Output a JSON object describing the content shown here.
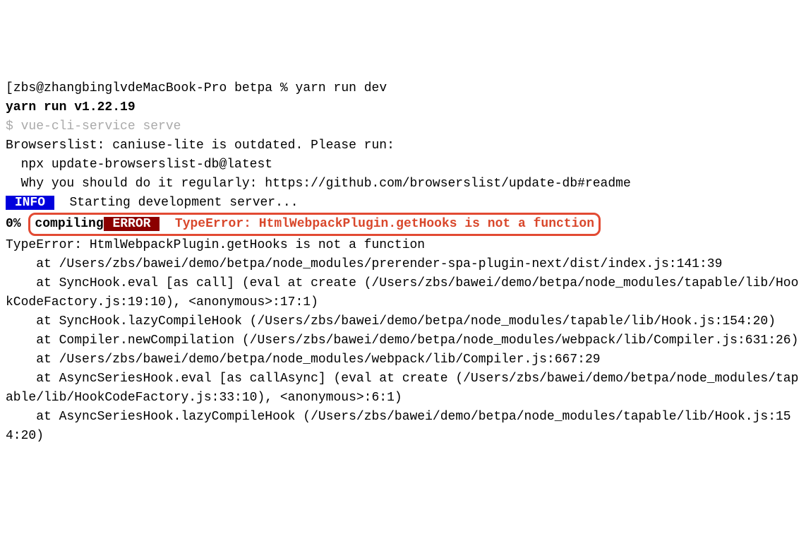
{
  "prompt": {
    "open_bracket": "[",
    "user_host": "zbs@zhangbinglvdeMacBook-Pro",
    "space1": " ",
    "dir": "betpa",
    "space2": " ",
    "pct": "%",
    "space3": " ",
    "command": "yarn run dev"
  },
  "yarn_version": "yarn run v1.22.19",
  "sub_prompt": {
    "dollar": "$",
    "space": " ",
    "cmd": "vue-cli-service serve"
  },
  "browserslist_line": "Browserslist: caniuse-lite is outdated. Please run:",
  "npx_line": "  npx update-browserslist-db@latest",
  "why_wrap": "  Why you should do it regularly: https://github.com/browserslist/update-db#readme",
  "info": {
    "pad": " ",
    "label": "INFO",
    "rest": "  Starting development server..."
  },
  "compile": {
    "pct": "0%",
    "space1": " ",
    "state": "compiling",
    "err": {
      "pad": " ",
      "label": "ERROR",
      "post": " ",
      "space": " ",
      "msg": "TypeError: HtmlWebpackPlugin.getHooks is not a function"
    }
  },
  "trace_head": "TypeError: HtmlWebpackPlugin.getHooks is not a function",
  "trace1": "    at /Users/zbs/bawei/demo/betpa/node_modules/prerender-spa-plugin-next/dist/index.js:141:39",
  "trace2": "    at SyncHook.eval [as call] (eval at create (/Users/zbs/bawei/demo/betpa/node_modules/tapable/lib/HookCodeFactory.js:19:10), <anonymous>:17:1)",
  "trace3": "    at SyncHook.lazyCompileHook (/Users/zbs/bawei/demo/betpa/node_modules/tapable/lib/Hook.js:154:20)",
  "trace4": "    at Compiler.newCompilation (/Users/zbs/bawei/demo/betpa/node_modules/webpack/lib/Compiler.js:631:26)",
  "trace5": "    at /Users/zbs/bawei/demo/betpa/node_modules/webpack/lib/Compiler.js:667:29",
  "trace6": "    at AsyncSeriesHook.eval [as callAsync] (eval at create (/Users/zbs/bawei/demo/betpa/node_modules/tapable/lib/HookCodeFactory.js:33:10), <anonymous>:6:1)",
  "trace7": "    at AsyncSeriesHook.lazyCompileHook (/Users/zbs/bawei/demo/betpa/node_modules/tapable/lib/Hook.js:154:20)"
}
